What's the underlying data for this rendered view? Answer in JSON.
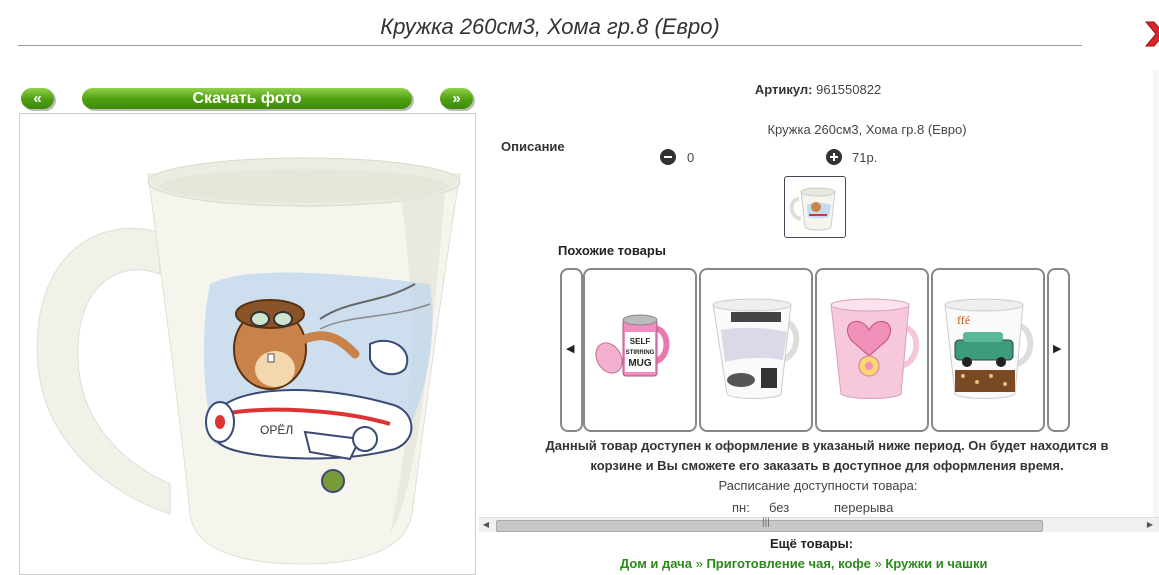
{
  "header": {
    "title": "Кружка 260см3, Хома гр.8 (Евро)"
  },
  "gallery": {
    "prev_label": "«",
    "download_label": "Скачать фото",
    "next_label": "»"
  },
  "product": {
    "sku_label": "Артикул:",
    "sku_value": "961550822",
    "description_label": "Описание",
    "description_text": "Кружка 260см3, Хома гр.8 (Евро)",
    "quantity": "0",
    "price": "71р."
  },
  "similar": {
    "title": "Похожие товары",
    "items": [
      {
        "name": "self-stirring-mug",
        "mug_text": "SELF STIRRING MUG"
      },
      {
        "name": "fashion-mug"
      },
      {
        "name": "pink-heart-mug"
      },
      {
        "name": "car-cafe-mug"
      }
    ]
  },
  "availability": {
    "text_line1": "Данный товар доступен к оформление в указаный ниже период. Он будет находится в",
    "text_line2": "корзине и Вы сможете его заказать в доступное для оформления время.",
    "schedule_title": "Расписание доступности товара:",
    "schedule_day": "пн:",
    "schedule_without": "без",
    "schedule_break": "перерыва"
  },
  "more": {
    "title": "Ещё товары:",
    "links": [
      "Дом и дача",
      "Приготовление чая, кофе",
      "Кружки и чашки"
    ],
    "separator": "»"
  },
  "colors": {
    "accent_green": "#4f9e12",
    "link_green": "#2a8a1a",
    "close_red": "#d8262b"
  }
}
